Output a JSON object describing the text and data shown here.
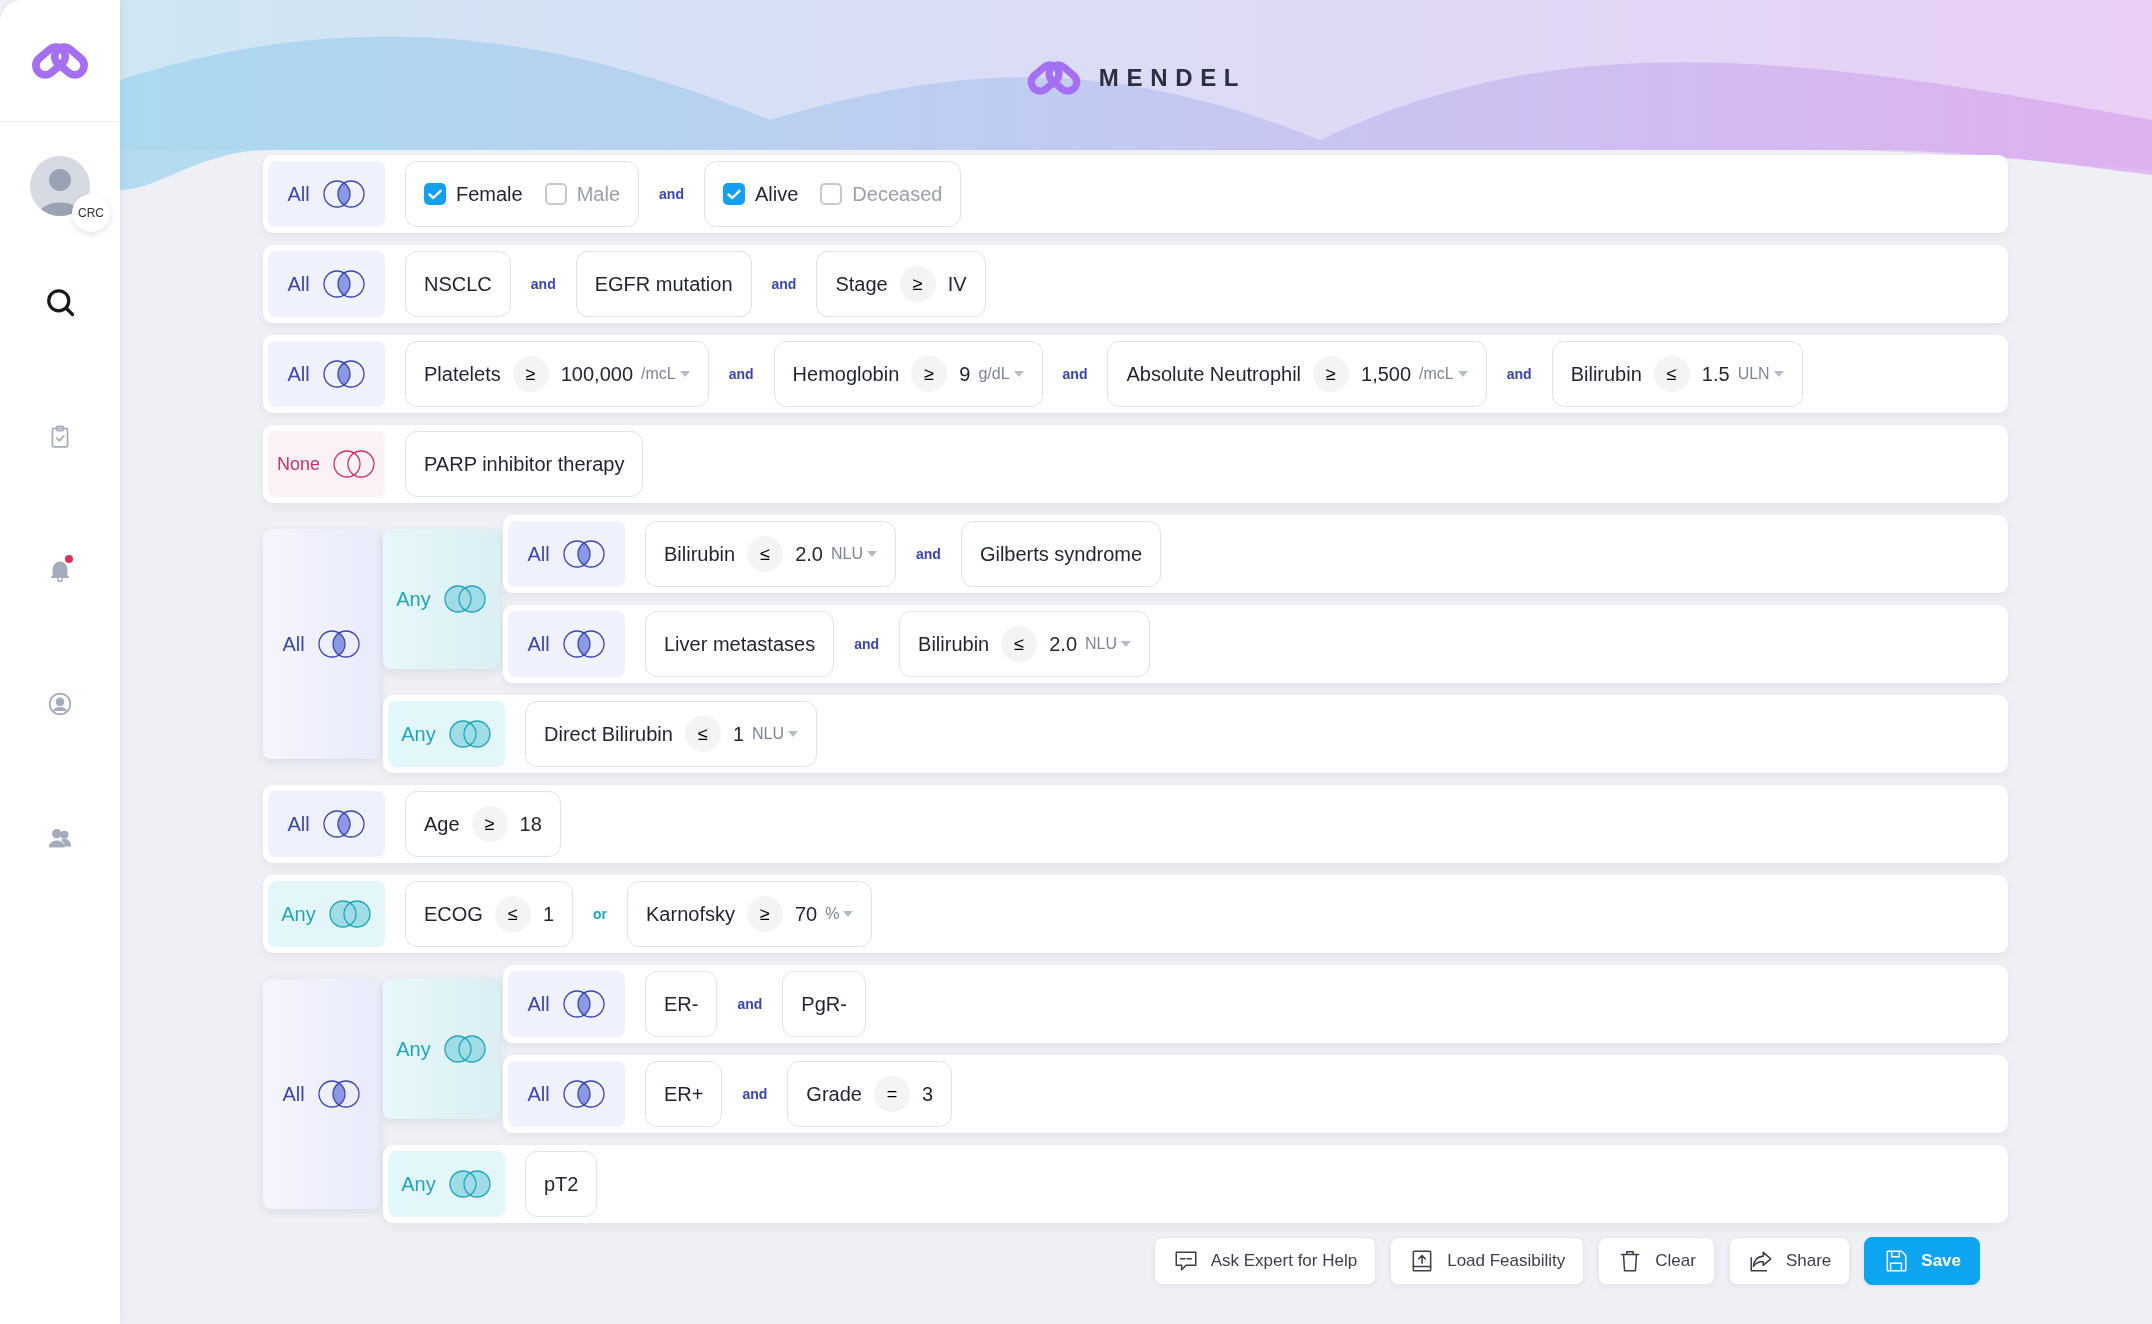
{
  "sidebar": {
    "avatar_badge": "CRC",
    "nav": [
      {
        "kind": "search",
        "selected": true,
        "alert": false
      },
      {
        "kind": "clipboard",
        "selected": false,
        "alert": false
      },
      {
        "kind": "bell",
        "selected": false,
        "alert": true
      },
      {
        "kind": "profile",
        "selected": false,
        "alert": false
      },
      {
        "kind": "team",
        "selected": false,
        "alert": false
      }
    ]
  },
  "header": {
    "brand": "MENDEL"
  },
  "groups": [
    {
      "kind": "all",
      "label": "All",
      "items": [
        {
          "kind": "checks",
          "options": [
            {
              "label": "Female",
              "checked": true
            },
            {
              "label": "Male",
              "checked": false
            }
          ]
        },
        {
          "kind": "checks",
          "joiner": "and",
          "options": [
            {
              "label": "Alive",
              "checked": true
            },
            {
              "label": "Deceased",
              "checked": false
            }
          ]
        }
      ]
    },
    {
      "kind": "all",
      "label": "All",
      "items": [
        {
          "kind": "text",
          "label": "NSCLC"
        },
        {
          "kind": "text",
          "joiner": "and",
          "label": "EGFR mutation"
        },
        {
          "kind": "compare",
          "joiner": "and",
          "name": "Stage",
          "op": "≥",
          "value": "IV"
        }
      ]
    },
    {
      "kind": "all",
      "label": "All",
      "items": [
        {
          "kind": "compare",
          "name": "Platelets",
          "op": "≥",
          "value": "100,000",
          "unit": "/mcL"
        },
        {
          "kind": "compare",
          "joiner": "and",
          "name": "Hemoglobin",
          "op": "≥",
          "value": "9",
          "unit": "g/dL"
        },
        {
          "kind": "compare",
          "joiner": "and",
          "name": "Absolute Neutrophil",
          "op": "≥",
          "value": "1,500",
          "unit": "/mcL"
        },
        {
          "kind": "compare",
          "joiner": "and",
          "name": "Bilirubin",
          "op": "≤",
          "value": "1.5",
          "unit": "ULN"
        }
      ]
    },
    {
      "kind": "none",
      "label": "None",
      "items": [
        {
          "kind": "text",
          "label": "PARP inhibitor therapy"
        }
      ]
    },
    {
      "kind": "all",
      "label": "All",
      "children": [
        {
          "kind": "any",
          "label": "Any",
          "children": [
            {
              "kind": "all",
              "label": "All",
              "items": [
                {
                  "kind": "compare",
                  "name": "Bilirubin",
                  "op": "≤",
                  "value": "2.0",
                  "unit": "NLU"
                },
                {
                  "kind": "text",
                  "joiner": "and",
                  "label": "Gilberts syndrome"
                }
              ]
            },
            {
              "kind": "all",
              "label": "All",
              "items": [
                {
                  "kind": "text",
                  "label": "Liver metastases"
                },
                {
                  "kind": "compare",
                  "joiner": "and",
                  "name": "Bilirubin",
                  "op": "≤",
                  "value": "2.0",
                  "unit": "NLU"
                }
              ]
            }
          ]
        },
        {
          "kind": "any",
          "label": "Any",
          "items": [
            {
              "kind": "compare",
              "name": "Direct Bilirubin",
              "op": "≤",
              "value": "1",
              "unit": "NLU"
            }
          ]
        }
      ]
    },
    {
      "kind": "all",
      "label": "All",
      "items": [
        {
          "kind": "compare",
          "name": "Age",
          "op": "≥",
          "value": "18"
        }
      ]
    },
    {
      "kind": "any",
      "label": "Any",
      "items": [
        {
          "kind": "compare",
          "name": "ECOG",
          "op": "≤",
          "value": "1"
        },
        {
          "kind": "compare",
          "joiner": "or",
          "name": "Karnofsky",
          "op": "≥",
          "value": "70",
          "unit": "%"
        }
      ]
    },
    {
      "kind": "all",
      "label": "All",
      "children": [
        {
          "kind": "any",
          "label": "Any",
          "children": [
            {
              "kind": "all",
              "label": "All",
              "items": [
                {
                  "kind": "text",
                  "label": "ER-"
                },
                {
                  "kind": "text",
                  "joiner": "and",
                  "label": "PgR-"
                }
              ]
            },
            {
              "kind": "all",
              "label": "All",
              "items": [
                {
                  "kind": "text",
                  "label": "ER+"
                },
                {
                  "kind": "compare",
                  "joiner": "and",
                  "name": "Grade",
                  "op": "=",
                  "value": "3"
                }
              ]
            }
          ]
        },
        {
          "kind": "any",
          "label": "Any",
          "items": [
            {
              "kind": "text",
              "label": "pT2"
            }
          ]
        }
      ]
    }
  ],
  "actions": [
    {
      "kind": "help",
      "label": "Ask Expert for Help",
      "primary": false
    },
    {
      "kind": "load",
      "label": "Load Feasibility",
      "primary": false
    },
    {
      "kind": "clear",
      "label": "Clear",
      "primary": false
    },
    {
      "kind": "share",
      "label": "Share",
      "primary": false
    },
    {
      "kind": "save",
      "label": "Save",
      "primary": true
    }
  ]
}
